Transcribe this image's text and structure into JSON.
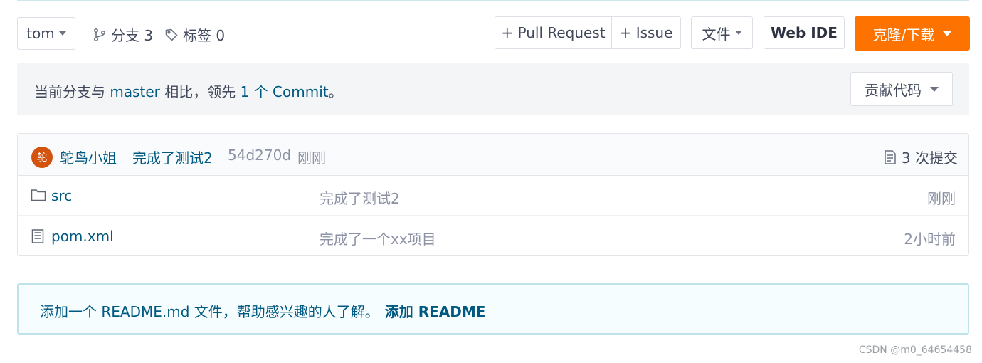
{
  "toolbar": {
    "branch_select": "tom",
    "branches_label": "分支 3",
    "tags_label": "标签 0",
    "pull_request_label": "+ Pull Request",
    "issue_label": "+ Issue",
    "files_label": "文件",
    "web_ide_label": "Web IDE",
    "clone_label": "克隆/下载"
  },
  "compare": {
    "prefix": "当前分支与 ",
    "branch": "master",
    "middle": " 相比，领先 ",
    "commit_link": "1 个 Commit",
    "suffix": "。",
    "contribute_label": "贡献代码"
  },
  "commit": {
    "avatar_text": "鸵",
    "author": "鸵鸟小姐",
    "message": "完成了测试2",
    "sha": "54d270d",
    "time": "刚刚",
    "count_label": "3 次提交"
  },
  "files": [
    {
      "name": "src",
      "type": "folder",
      "message": "完成了测试2",
      "time": "刚刚"
    },
    {
      "name": "pom.xml",
      "type": "file",
      "message": "完成了一个xx项目",
      "time": "2小时前"
    }
  ],
  "readme": {
    "text": "添加一个 README.md 文件，帮助感兴趣的人了解。",
    "link": "添加 README"
  },
  "watermark": "CSDN @m0_64654458",
  "colors": {
    "accent": "#fe7300",
    "link": "#005980",
    "avatar": "#d3520e"
  }
}
